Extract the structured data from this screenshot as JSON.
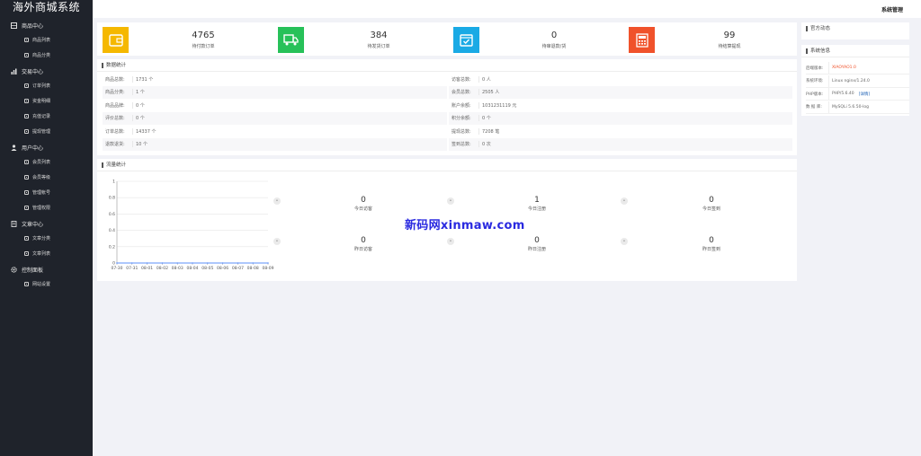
{
  "app": {
    "title": "海外商城系统"
  },
  "sidebar": {
    "groups": [
      {
        "label": "商品中心",
        "icon": "grid-icon",
        "items": [
          "商品列表",
          "商品分类"
        ]
      },
      {
        "label": "交易中心",
        "icon": "chart-icon",
        "items": [
          "订单列表",
          "资金明细",
          "充值记录",
          "提现管理"
        ]
      },
      {
        "label": "用户中心",
        "icon": "user-icon",
        "items": [
          "会员列表",
          "会员等级",
          "管理帐号",
          "管理权限"
        ]
      },
      {
        "label": "文章中心",
        "icon": "document-icon",
        "items": [
          "文章分类",
          "文章列表"
        ]
      },
      {
        "label": "控制面板",
        "icon": "gear-icon",
        "items": [
          "网站设置"
        ]
      }
    ]
  },
  "topbar": {
    "admin_label": "系统管理"
  },
  "stats": [
    {
      "value": "4765",
      "label": "待付款订单",
      "color": "#f5b800",
      "icon": "wallet-icon"
    },
    {
      "value": "384",
      "label": "待发货订单",
      "color": "#27c159",
      "icon": "truck-icon"
    },
    {
      "value": "0",
      "label": "待审退款/货",
      "color": "#1aaae5",
      "icon": "check-calendar-icon"
    },
    {
      "value": "99",
      "label": "待结算提现",
      "color": "#f0522b",
      "icon": "calculator-icon"
    }
  ],
  "data_stats": {
    "title": "数据统计",
    "left": [
      {
        "key": "商品总数:",
        "value": "1731 个"
      },
      {
        "key": "商品分类:",
        "value": "1 个"
      },
      {
        "key": "商品品牌:",
        "value": "0 个"
      },
      {
        "key": "评价总数:",
        "value": "0 个"
      },
      {
        "key": "订单总数:",
        "value": "14337 个"
      },
      {
        "key": "退款退货:",
        "value": "10 个"
      }
    ],
    "right": [
      {
        "key": "访客总数:",
        "value": "0 人"
      },
      {
        "key": "会员总数:",
        "value": "2505 人"
      },
      {
        "key": "账户余额:",
        "value": "1031231119 元"
      },
      {
        "key": "积分余额:",
        "value": "0 个"
      },
      {
        "key": "提现总数:",
        "value": "7208 笔"
      },
      {
        "key": "签到总数:",
        "value": "0 次"
      }
    ]
  },
  "traffic": {
    "title": "流量统计",
    "metrics": [
      {
        "value": "0",
        "label": "今日访客"
      },
      {
        "value": "1",
        "label": "今日注册"
      },
      {
        "value": "0",
        "label": "今日签到"
      },
      {
        "value": "0",
        "label": "昨日访客"
      },
      {
        "value": "0",
        "label": "昨日注册"
      },
      {
        "value": "0",
        "label": "昨日签到"
      }
    ]
  },
  "chart_data": {
    "type": "line",
    "x": [
      "07-30",
      "07-31",
      "08-01",
      "08-02",
      "08-03",
      "08-04",
      "08-05",
      "08-06",
      "08-07",
      "08-08",
      "08-09"
    ],
    "series": [
      {
        "values": [
          0,
          0,
          0,
          0,
          0,
          0,
          0,
          0,
          0,
          0,
          0
        ]
      }
    ],
    "yticks": [
      "0",
      "0.2",
      "0.4",
      "0.6",
      "0.8",
      "1"
    ],
    "ylim": [
      0,
      1
    ],
    "grid": true,
    "line_color": "#5b8ff9"
  },
  "side": {
    "official_title": "官方动态",
    "system_title": "系统信息",
    "system_rows": [
      {
        "key": "后端版本:",
        "value": "XIAOYAO1.0",
        "accent": true
      },
      {
        "key": "系统环境:",
        "value": "Linux nginx/1.24.0"
      },
      {
        "key": "PHP版本:",
        "value": "PHP/5.6.40",
        "extra": "[详情]"
      },
      {
        "key": "数 据 库:",
        "value": "MySQLi 5.6.50-log"
      }
    ]
  },
  "watermark": "新码网xinmaw.com"
}
